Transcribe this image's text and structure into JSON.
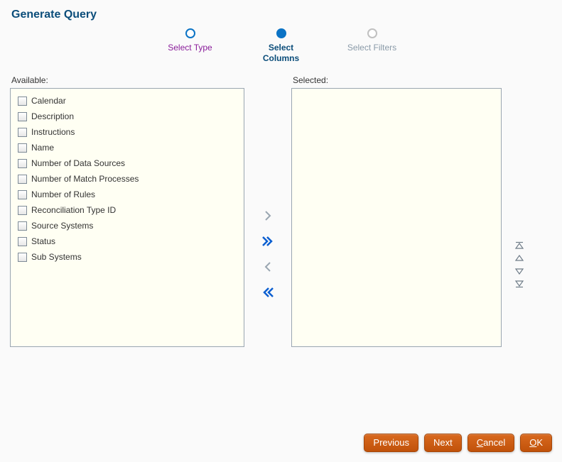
{
  "title": "Generate Query",
  "steps": [
    {
      "label": "Select Type",
      "state": "visited"
    },
    {
      "label": "Select Columns",
      "state": "current"
    },
    {
      "label": "Select Filters",
      "state": "disabled"
    }
  ],
  "available": {
    "title": "Available:",
    "items": [
      "Calendar",
      "Description",
      "Instructions",
      "Name",
      "Number of Data Sources",
      "Number of Match Processes",
      "Number of Rules",
      "Reconciliation Type ID",
      "Source Systems",
      "Status",
      "Sub Systems"
    ]
  },
  "selected": {
    "title": "Selected:",
    "items": []
  },
  "shuttle": {
    "move": {
      "name": "move-right",
      "active": false
    },
    "moveAll": {
      "name": "move-all-right",
      "active": true
    },
    "remove": {
      "name": "move-left",
      "active": false
    },
    "removeAll": {
      "name": "move-all-left",
      "active": true
    }
  },
  "reorder": {
    "top": {
      "name": "move-top"
    },
    "up": {
      "name": "move-up"
    },
    "down": {
      "name": "move-down"
    },
    "bottom": {
      "name": "move-bottom"
    }
  },
  "buttons": {
    "previous": "Previous",
    "next": "Next",
    "cancel": "Cancel",
    "cancel_accel": "C",
    "cancel_rest": "ancel",
    "ok": "OK",
    "ok_accel": "O",
    "ok_rest": "K"
  }
}
